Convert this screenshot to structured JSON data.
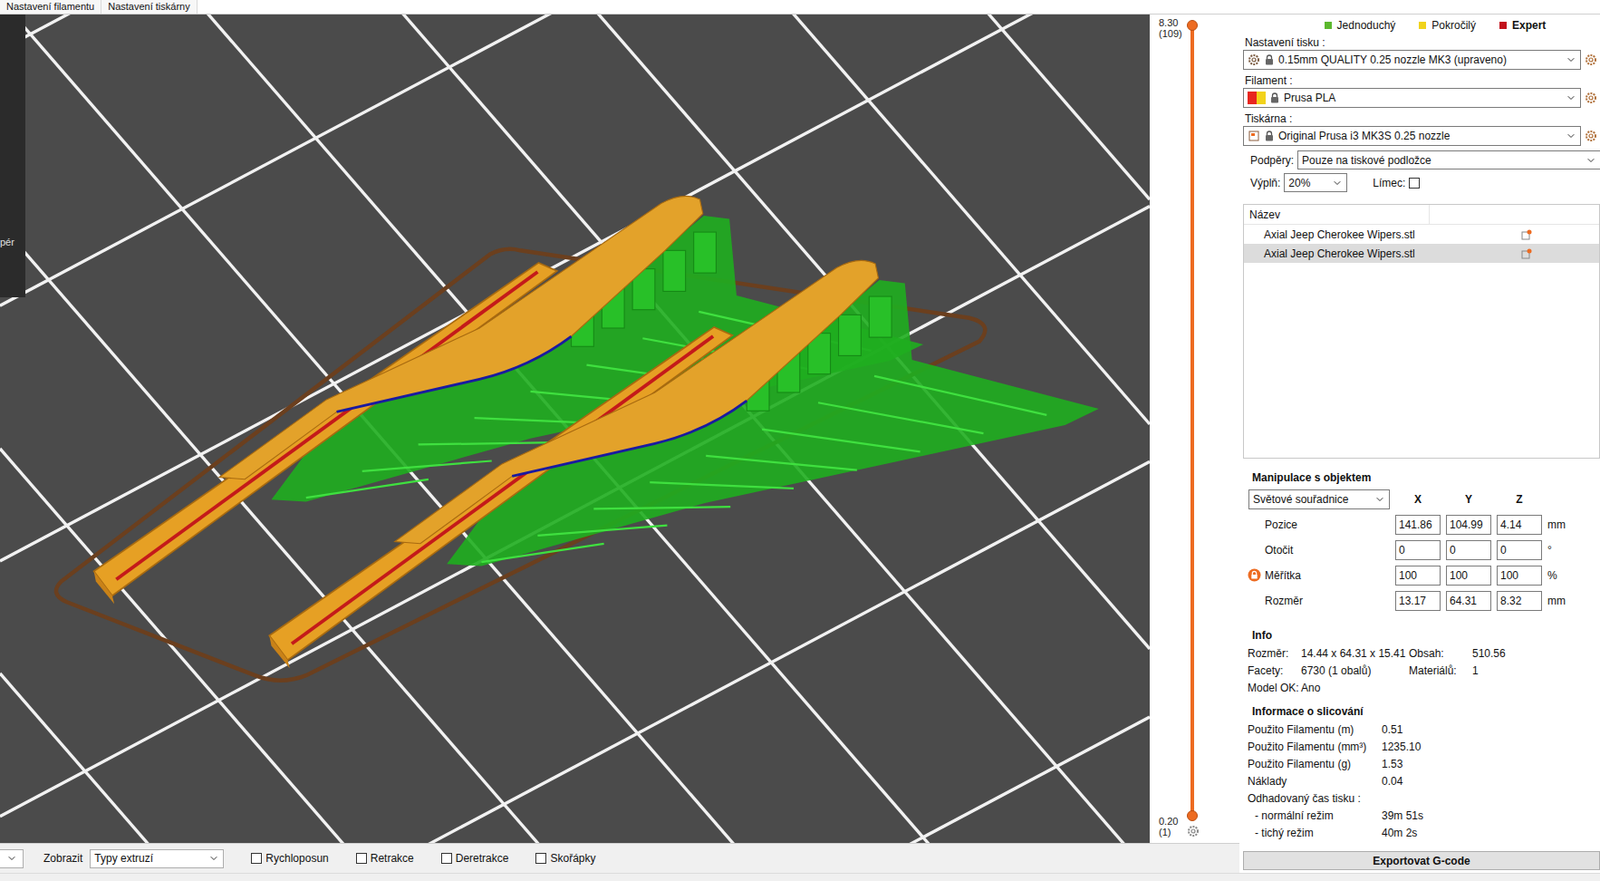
{
  "tabs": [
    {
      "label": "Nastavení filamentu",
      "selected": false
    },
    {
      "label": "Nastavení tiskárny",
      "selected": false
    }
  ],
  "left_panel": {
    "label": "pér"
  },
  "layer_slider": {
    "top_value": "8.30",
    "top_layer": "(109)",
    "bottom_value": "0.20",
    "bottom_layer": "(1)",
    "upper_level": 1,
    "lower_level": 0
  },
  "modes": [
    {
      "label": "Jednoduchý",
      "selected": false,
      "color": "#5cb82e"
    },
    {
      "label": "Pokročilý",
      "selected": false,
      "color": "#f0d31c"
    },
    {
      "label": "Expert",
      "selected": true,
      "color": "#c2121c"
    }
  ],
  "presets": [
    {
      "label": "Nastavení tisku :",
      "value": "0.15mm QUALITY 0.25 nozzle MK3 (upraveno)",
      "kind": "print",
      "colors": []
    },
    {
      "label": "Filament :",
      "value": "Prusa PLA",
      "kind": "filament",
      "colors": [
        "#e8261f",
        "#f2d21b"
      ]
    },
    {
      "label": "Tiskárna :",
      "value": "Original Prusa i3 MK3S 0.25 nozzle",
      "kind": "printer",
      "colors": []
    }
  ],
  "supports": {
    "label": "Podpěry:",
    "value": "Pouze na tiskové podložce"
  },
  "infill": {
    "label": "Výplň:",
    "value": "20%"
  },
  "brim": {
    "label": "Límec:",
    "checked": false
  },
  "object_list": {
    "column": "Název",
    "rows": [
      {
        "name": "Axial Jeep Cherokee Wipers.stl",
        "selected": false
      },
      {
        "name": "Axial Jeep Cherokee Wipers.stl",
        "selected": true
      }
    ]
  },
  "manipulation": {
    "title": "Manipulace s objektem",
    "coordinates": "Světové souřadnice",
    "axes": [
      "X",
      "Y",
      "Z"
    ],
    "rows": [
      {
        "label": "Pozice",
        "values": [
          "141.86",
          "104.99",
          "4.14"
        ],
        "unit": "mm",
        "locked": false
      },
      {
        "label": "Otočit",
        "values": [
          "0",
          "0",
          "0"
        ],
        "unit": "°",
        "locked": false
      },
      {
        "label": "Měřítka",
        "values": [
          "100",
          "100",
          "100"
        ],
        "unit": "%",
        "locked": true
      },
      {
        "label": "Rozměr",
        "values": [
          "13.17",
          "64.31",
          "8.32"
        ],
        "unit": "mm",
        "locked": false
      }
    ]
  },
  "info": {
    "title": "Info",
    "rows": [
      [
        {
          "label": "Rozměr:",
          "value": "14.44 x 64.31 x 15.41"
        },
        {
          "label": "Obsah:",
          "value": "510.56"
        }
      ],
      [
        {
          "label": "Facety:",
          "value": "6730 (1 obalů)"
        },
        {
          "label": "Materiálů:",
          "value": "1"
        }
      ],
      [
        {
          "label": "Model OK:",
          "value": "Ano"
        }
      ]
    ]
  },
  "slicing": {
    "title": "Informace o slicování",
    "rows": [
      {
        "label": "Použito Filamentu (m)",
        "value": "0.51",
        "kind": "value"
      },
      {
        "label": "Použito Filamentu (mm³)",
        "value": "1235.10",
        "kind": "value"
      },
      {
        "label": "Použito Filamentu (g)",
        "value": "1.53",
        "kind": "value"
      },
      {
        "label": "Náklady",
        "value": "0.04",
        "kind": "value"
      },
      {
        "label": "Odhadovaný čas tisku :",
        "value": "",
        "kind": "header"
      },
      {
        "label": "- normální režim",
        "value": "39m 51s",
        "kind": "sub"
      },
      {
        "label": "- tichý režim",
        "value": "40m 2s",
        "kind": "sub"
      }
    ]
  },
  "export_button": "Exportovat G-code",
  "bottom_bar": {
    "view_label": "Zobrazit",
    "view_value": "Typy extruzí",
    "options": [
      {
        "label": "Rychloposun",
        "checked": false
      },
      {
        "label": "Retrakce",
        "checked": false
      },
      {
        "label": "Deretrakce",
        "checked": false
      },
      {
        "label": "Skořápky",
        "checked": false
      }
    ]
  }
}
